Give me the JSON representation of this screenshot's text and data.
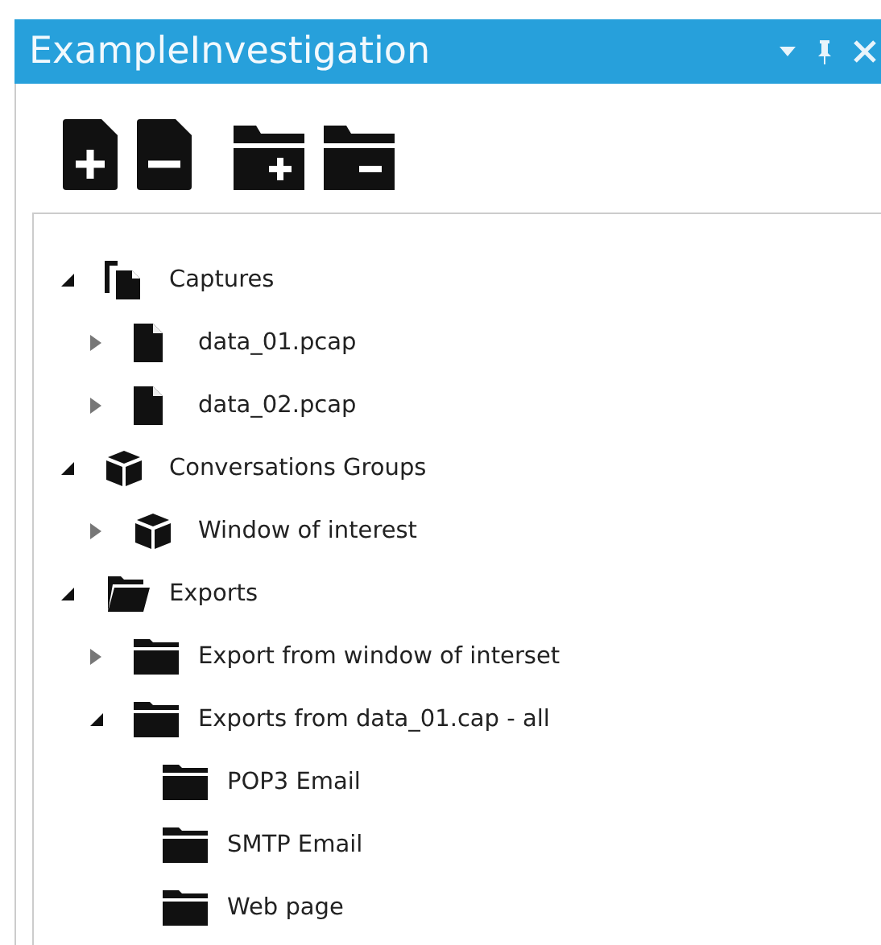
{
  "window": {
    "title": "ExampleInvestigation"
  },
  "toolbar": {
    "buttons": [
      {
        "kind": "file-add"
      },
      {
        "kind": "file-remove"
      },
      {
        "kind": "folder-add"
      },
      {
        "kind": "folder-remove"
      }
    ]
  },
  "tree": [
    {
      "label": "Captures",
      "kind": "files",
      "expanded": true,
      "children": [
        {
          "label": "data_01.pcap",
          "kind": "file",
          "expanded": false
        },
        {
          "label": "data_02.pcap",
          "kind": "file",
          "expanded": false
        }
      ]
    },
    {
      "label": "Conversations Groups",
      "kind": "cube",
      "expanded": true,
      "children": [
        {
          "label": "Window of interest",
          "kind": "cube",
          "expanded": false
        }
      ]
    },
    {
      "label": "Exports",
      "kind": "folder-open",
      "expanded": true,
      "children": [
        {
          "label": "Export from window of interset",
          "kind": "folder",
          "expanded": false
        },
        {
          "label": "Exports from data_01.cap - all",
          "kind": "folder",
          "expanded": true,
          "children": [
            {
              "label": "POP3 Email",
              "kind": "folder"
            },
            {
              "label": "SMTP Email",
              "kind": "folder"
            },
            {
              "label": "Web page",
              "kind": "folder"
            }
          ]
        }
      ]
    }
  ]
}
